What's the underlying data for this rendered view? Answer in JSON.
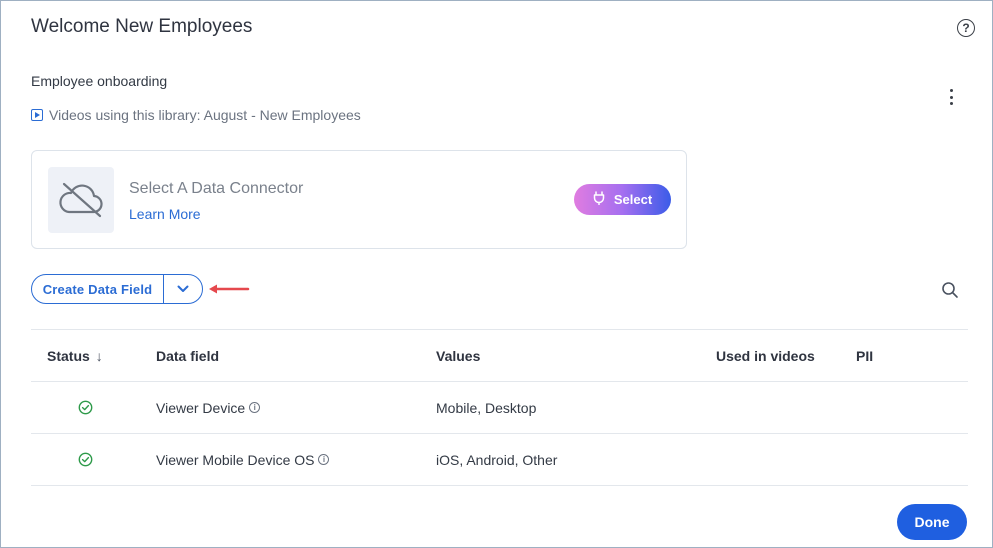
{
  "dialog": {
    "title": "Welcome New Employees",
    "subtitle": "Employee onboarding",
    "videos_line": "Videos using this library: August - New Employees"
  },
  "connector": {
    "title": "Select A Data Connector",
    "learn_more": "Learn More",
    "select_label": "Select"
  },
  "toolbar": {
    "create_label": "Create Data Field"
  },
  "table": {
    "headers": {
      "status": "Status",
      "field": "Data field",
      "values": "Values",
      "used": "Used in videos",
      "pii": "PII"
    },
    "rows": [
      {
        "status": "ok",
        "field": "Viewer Device",
        "values": "Mobile, Desktop",
        "used": "",
        "pii": ""
      },
      {
        "status": "ok",
        "field": "Viewer Mobile Device OS",
        "values": "iOS, Android, Other",
        "used": "",
        "pii": ""
      }
    ]
  },
  "footer": {
    "done_label": "Done"
  },
  "colors": {
    "accent": "#2b6cd4",
    "done": "#1f5fe0",
    "success": "#2e9a4a",
    "annotation_arrow": "#e5484d"
  }
}
